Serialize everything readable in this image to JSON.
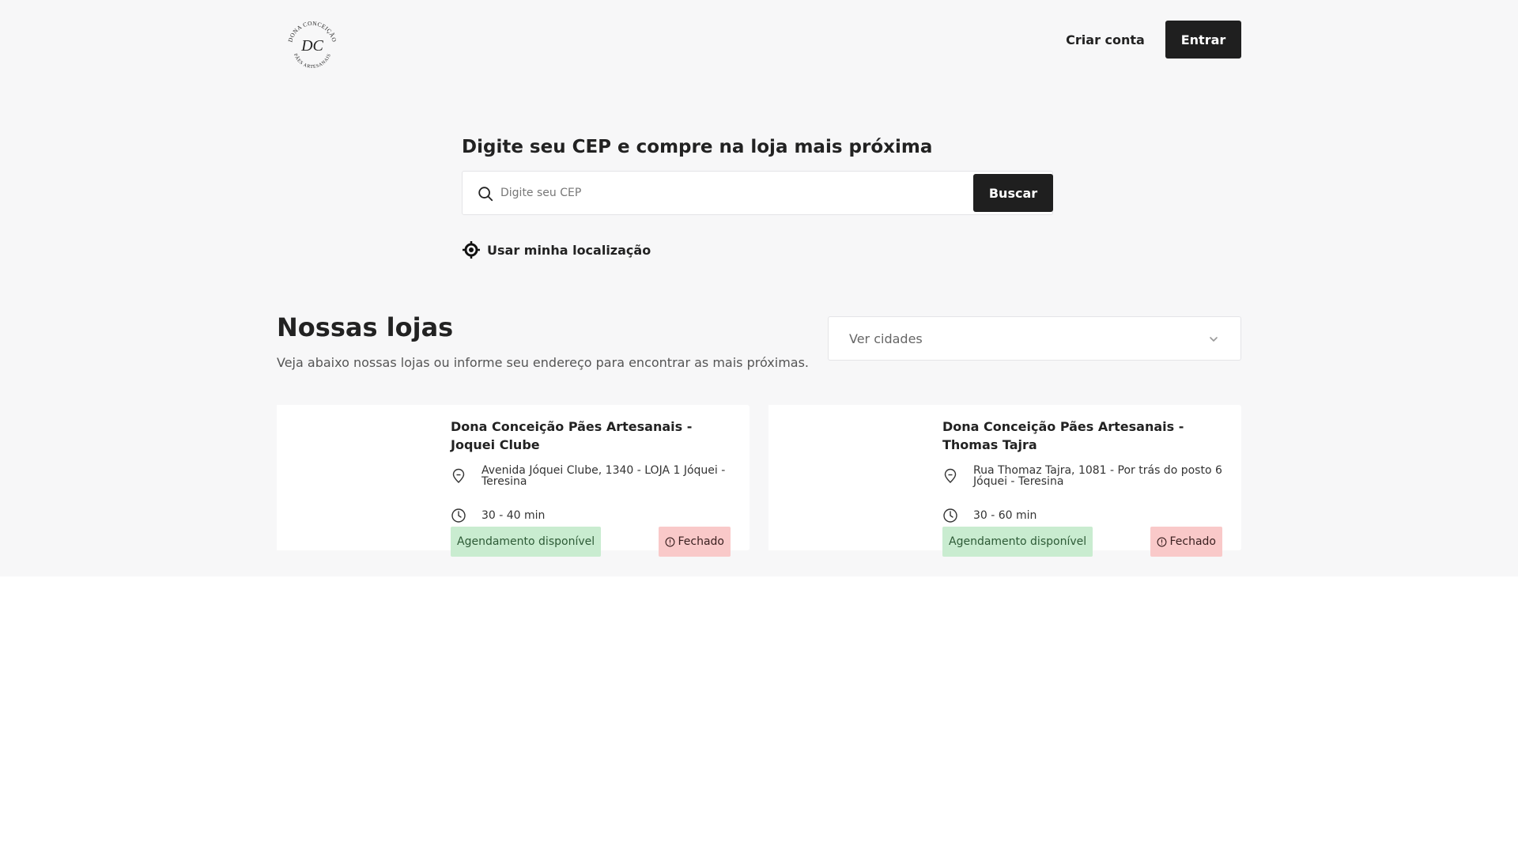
{
  "header": {
    "logo": {
      "top_text": "DONA CONCEIÇÃO",
      "monogram": "DC",
      "bottom_text": "PÃES ARTESANAIS"
    },
    "create_account_label": "Criar conta",
    "login_label": "Entrar"
  },
  "cep_search": {
    "title": "Digite seu CEP e compre na loja mais próxima",
    "placeholder": "Digite seu CEP",
    "button_label": "Buscar",
    "use_location_label": "Usar minha localização"
  },
  "stores": {
    "title": "Nossas lojas",
    "subtitle": "Veja abaixo nossas lojas ou informe seu endereço para encontrar as mais próximas.",
    "city_select_label": "Ver cidades",
    "items": [
      {
        "name": "Dona Conceição Pães Artesanais - Joquei Clube",
        "address": "Avenida Jóquei Clube, 1340 - LOJA 1 Jóquei - Teresina",
        "delivery_time": "30 - 40 min",
        "scheduling_badge": "Agendamento disponível",
        "status_badge": "Fechado"
      },
      {
        "name": "Dona Conceição Pães Artesanais - Thomas Tajra",
        "address": "Rua Thomaz Tajra, 1081 - Por trás do posto 6 Jóquei - Teresina",
        "delivery_time": "30 - 60 min",
        "scheduling_badge": "Agendamento disponível",
        "status_badge": "Fechado"
      }
    ]
  },
  "colors": {
    "top_background": "#f7f7f8",
    "primary_button": "#1f1f1f",
    "scheduling_badge_bg": "#c9ecd0",
    "closed_badge_bg": "#f9c9c9"
  },
  "icons": [
    "search-icon",
    "crosshair-icon",
    "chevron-down-icon",
    "map-pin-icon",
    "clock-icon",
    "alert-circle-icon"
  ]
}
